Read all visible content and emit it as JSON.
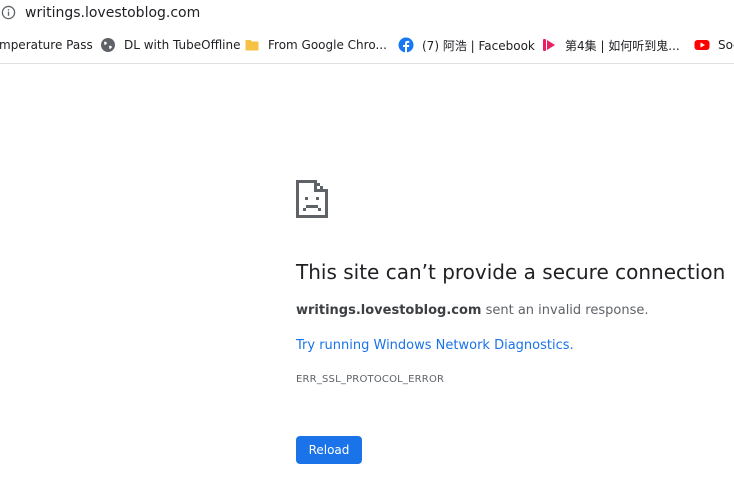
{
  "address_bar": {
    "url": "writings.lovestoblog.com"
  },
  "bookmarks": [
    {
      "label": "mperature Pass",
      "icon": "none"
    },
    {
      "label": "DL with TubeOffline",
      "icon": "globe-icon"
    },
    {
      "label": "From Google Chro...",
      "icon": "folder-icon"
    },
    {
      "label": "(7) 阿浩 | Facebook",
      "icon": "facebook-icon"
    },
    {
      "label": "第4集 | 如何听到鬼...",
      "icon": "play-icon"
    },
    {
      "label": "Soc",
      "icon": "youtube-icon"
    }
  ],
  "error": {
    "title": "This site can’t provide a secure connection",
    "domain": "writings.lovestoblog.com",
    "desc_rest": " sent an invalid response.",
    "link_text": "Try running Windows Network Diagnostics",
    "link_suffix": ".",
    "code": "ERR_SSL_PROTOCOL_ERROR",
    "reload_label": "Reload"
  },
  "colors": {
    "accent": "#1a73e8",
    "facebook": "#1877f2",
    "youtube": "#ff0000",
    "play": "#e91e63",
    "folder": "#f6c244"
  }
}
